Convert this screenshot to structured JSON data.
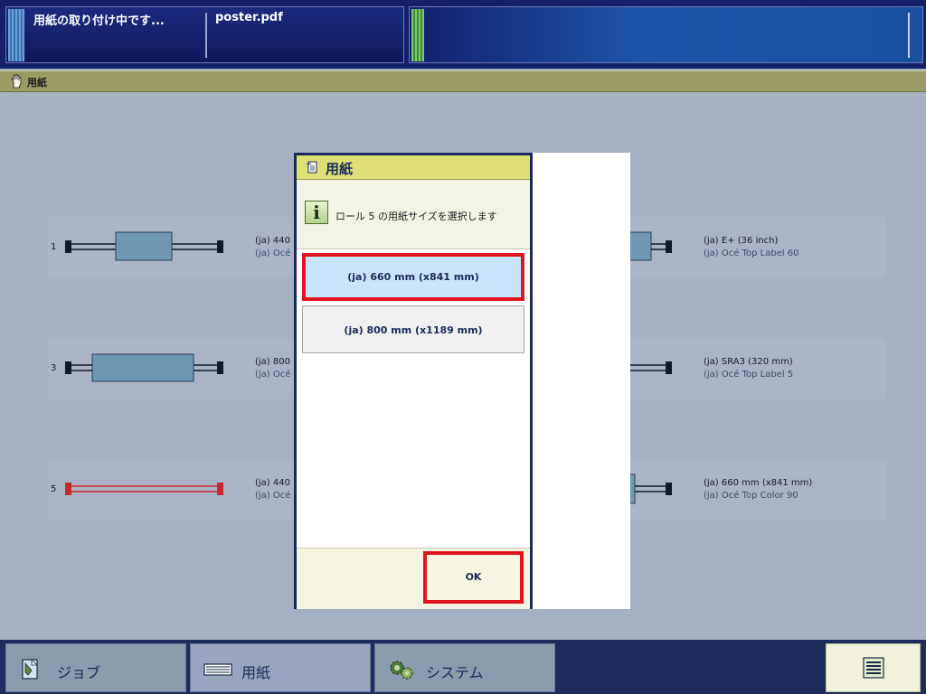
{
  "header": {
    "job_status": "用紙の取り付け中です...",
    "file_name": "poster.pdf"
  },
  "section": {
    "title": "用紙",
    "icon": "hand-icon"
  },
  "rolls": [
    {
      "number": "1",
      "size": "(ja) 440",
      "media": "(ja) Océ"
    },
    {
      "number": "3",
      "size": "(ja) 800",
      "media": "(ja) Océ"
    },
    {
      "number": "5",
      "size": "(ja) 440",
      "media": "(ja) Océ"
    }
  ],
  "rolls_right": [
    {
      "size": "(ja) E+ (36 inch)",
      "media": "(ja) Océ Top Label 60"
    },
    {
      "size": "(ja) SRA3 (320 mm)",
      "media": "(ja) Océ Top Label 5"
    },
    {
      "size": "(ja) 660 mm (x841 mm)",
      "media": "(ja) Océ Top Color 90"
    }
  ],
  "dialog": {
    "title": "用紙",
    "info_text": "ロール 5 の用紙サイズを選択します",
    "options": [
      "(ja) 660 mm (x841 mm)",
      "(ja) 800 mm (x1189 mm)"
    ],
    "selected_option": "(ja) 660 mm (x841 mm)",
    "ok_label": "OK"
  },
  "nav": {
    "job": "ジョブ",
    "paper": "用紙",
    "system": "システム"
  },
  "colors": {
    "header_bg": "#14206a",
    "section_bar": "#9a9c64",
    "dialog_title_bg": "#dfdf78",
    "highlight_border": "#e0141e",
    "selected_option_bg": "#c8e4fa",
    "active_roll_red": "#c8282a"
  }
}
